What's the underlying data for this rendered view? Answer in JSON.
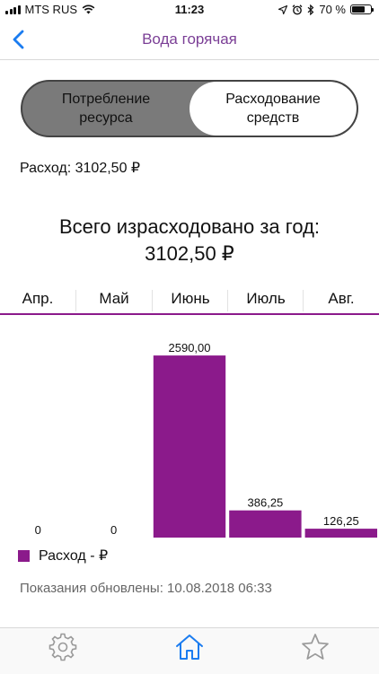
{
  "status_bar": {
    "carrier": "MTS RUS",
    "time": "11:23",
    "battery_percent": "70 %",
    "battery_level": 0.7
  },
  "nav": {
    "back_icon": "chevron-left-icon",
    "title": "Вода горячая"
  },
  "segment": {
    "left_label": "Потребление ресурса",
    "right_label": "Расходование средств",
    "selected": "right"
  },
  "expense": "Расход: 3102,50 ₽",
  "total": {
    "line1": "Всего израсходовано за год:",
    "line2": "3102,50 ₽"
  },
  "months": [
    "Апр.",
    "Май",
    "Июнь",
    "Июль",
    "Авг."
  ],
  "chart_data": {
    "type": "bar",
    "categories": [
      "Апр.",
      "Май",
      "Июнь",
      "Июль",
      "Авг."
    ],
    "values": [
      0,
      0,
      2590.0,
      386.25,
      126.25
    ],
    "value_labels": [
      "0",
      "0",
      "2590,00",
      "386,25",
      "126,25"
    ],
    "ylim": [
      0,
      3000
    ],
    "grid": false,
    "series": [
      {
        "name": "Расход - ₽",
        "color": "#8b1a8b"
      }
    ],
    "legend_position": "bottom-left"
  },
  "legend_label": "Расход - ₽",
  "updated": "Показания обновлены: 10.08.2018 06:33",
  "tabs": [
    {
      "icon": "gear-icon",
      "active": false
    },
    {
      "icon": "home-icon",
      "active": true
    },
    {
      "icon": "star-icon",
      "active": false
    }
  ],
  "colors": {
    "accent": "#8b1a8b",
    "title": "#7b3f96",
    "ios_blue": "#1a7cf0"
  }
}
